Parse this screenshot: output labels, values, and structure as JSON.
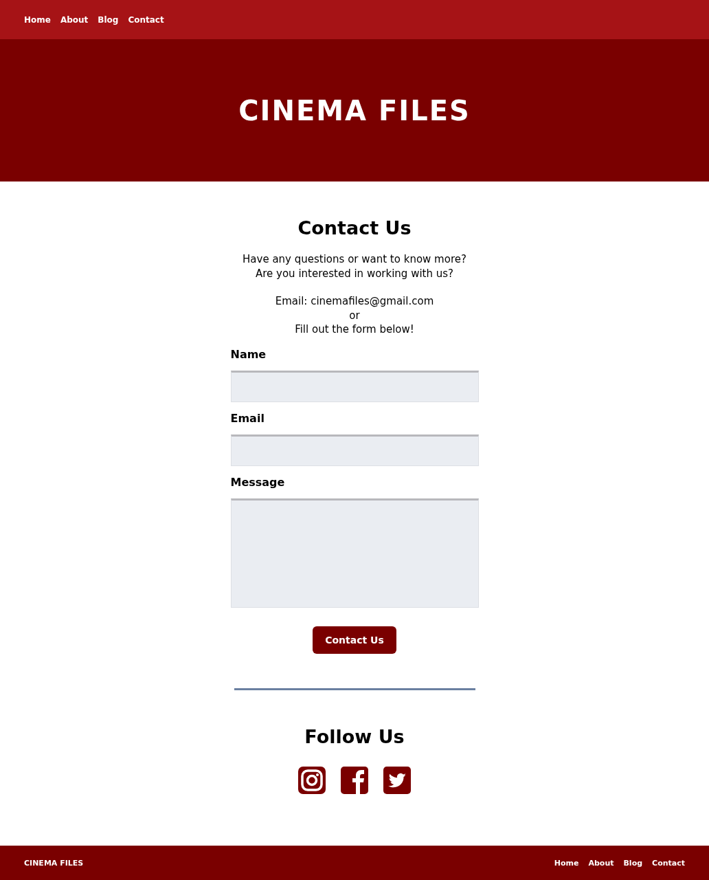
{
  "top_nav": [
    "Home",
    "About",
    "Blog",
    "Contact"
  ],
  "hero": {
    "title": "CINEMA FILES"
  },
  "contact": {
    "heading": "Contact Us",
    "intro": [
      [
        "Have any questions or want to know more?",
        "Are you interested in working with us?"
      ],
      [
        "Email: cinemafiles@gmail.com",
        "or",
        "Fill out the form below!"
      ]
    ],
    "fields": [
      {
        "label": "Name",
        "kind": "text"
      },
      {
        "label": "Email",
        "kind": "text"
      },
      {
        "label": "Message",
        "kind": "textarea"
      }
    ],
    "submit": "Contact Us"
  },
  "follow": {
    "heading": "Follow Us"
  },
  "footer": {
    "brand": "CINEMA FILES",
    "nav": [
      "Home",
      "About",
      "Blog",
      "Contact"
    ]
  }
}
